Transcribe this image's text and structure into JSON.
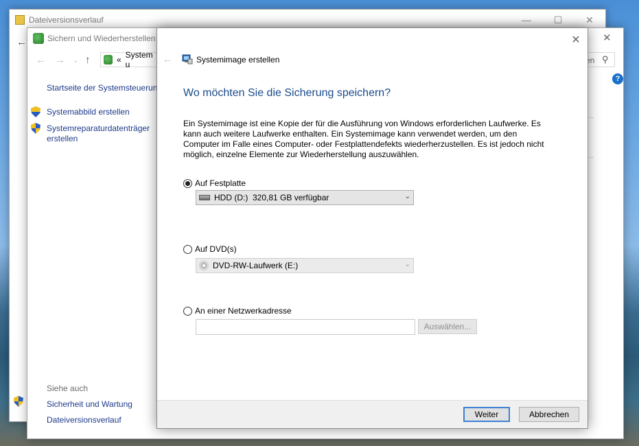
{
  "back_window": {
    "title": "Dateiversionsverlauf"
  },
  "control_panel": {
    "title": "Sichern und Wiederherstellen (",
    "address_prefix": "«",
    "address_text": "System u",
    "search_fragment": "en",
    "home_link": "Startseite der Systemsteuerung",
    "tasks": [
      "Systemabbild erstellen",
      "Systemreparaturdatenträger erstellen"
    ],
    "task2_line1": "Systemreparaturdatenträger",
    "task2_line2": "erstellen",
    "see_also_label": "Siehe auch",
    "see_also_links": [
      "Sicherheit und Wartung",
      "Dateiversionsverlauf"
    ],
    "help_glyph": "?"
  },
  "dialog": {
    "title": "Systemimage erstellen",
    "heading": "Wo möchten Sie die Sicherung speichern?",
    "description": "Ein Systemimage ist eine Kopie der für die Ausführung von Windows erforderlichen Laufwerke. Es kann auch weitere Laufwerke enthalten. Ein Systemimage kann verwendet werden, um den Computer im Falle eines Computer- oder Festplattendefekts wiederherzustellen. Es ist jedoch nicht möglich, einzelne Elemente zur Wiederherstellung auszuwählen.",
    "options": {
      "hard_disk": {
        "label": "Auf Festplatte",
        "checked": true,
        "selected": "HDD (D:)  320,81 GB verfügbar"
      },
      "dvd": {
        "label": "Auf DVD(s)",
        "checked": false,
        "selected": "DVD-RW-Laufwerk (E:)"
      },
      "network": {
        "label": "An einer Netzwerkadresse",
        "checked": false,
        "input_value": "",
        "browse_label": "Auswählen..."
      }
    },
    "next_label": "Weiter",
    "cancel_label": "Abbrechen"
  },
  "colors": {
    "link": "#1e3a8a",
    "heading": "#1a4a8a",
    "default_button_border": "#3c7fd3"
  }
}
